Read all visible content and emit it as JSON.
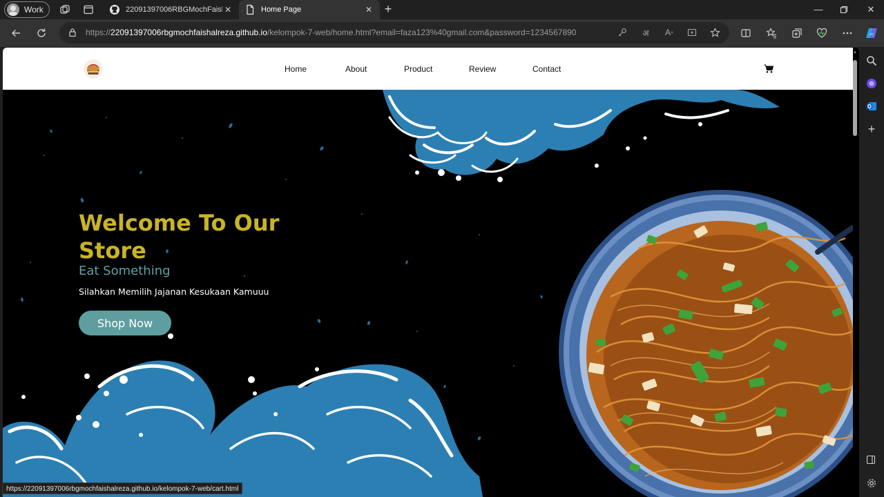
{
  "browser": {
    "profile_label": "Work",
    "tabs": [
      {
        "title": "22091397006RBGMochFaishalRe",
        "icon": "github-icon",
        "active": false
      },
      {
        "title": "Home Page",
        "icon": "page-icon",
        "active": true
      }
    ],
    "url_prefix": "https://",
    "url_host": "22091397006rbgmochfaishalreza.github.io",
    "url_path": "/kelompok-7-web/home.html?email=faza123%40gmail.com&password=1234567890",
    "status_url": "https://22091397006rbgmochfaishalreza.github.io/kelompok-7-web/cart.html"
  },
  "site": {
    "nav": {
      "items": [
        {
          "label": "Home"
        },
        {
          "label": "About"
        },
        {
          "label": "Product"
        },
        {
          "label": "Review"
        },
        {
          "label": "Contact"
        }
      ],
      "cart_icon": "cart-icon"
    },
    "hero": {
      "title": "Welcome To Our Store",
      "subtitle": "Eat Something",
      "text": "Silahkan Memilih Jajanan Kesukaan Kamuuu",
      "button": "Shop Now"
    }
  },
  "colors": {
    "hero_title": "#c8b426",
    "hero_subtitle": "#5ea1a6",
    "button": "#5f9ea0",
    "wave": "#2c7fb2",
    "chrome_dark": "#202020",
    "chrome_toolbar": "#333333"
  }
}
